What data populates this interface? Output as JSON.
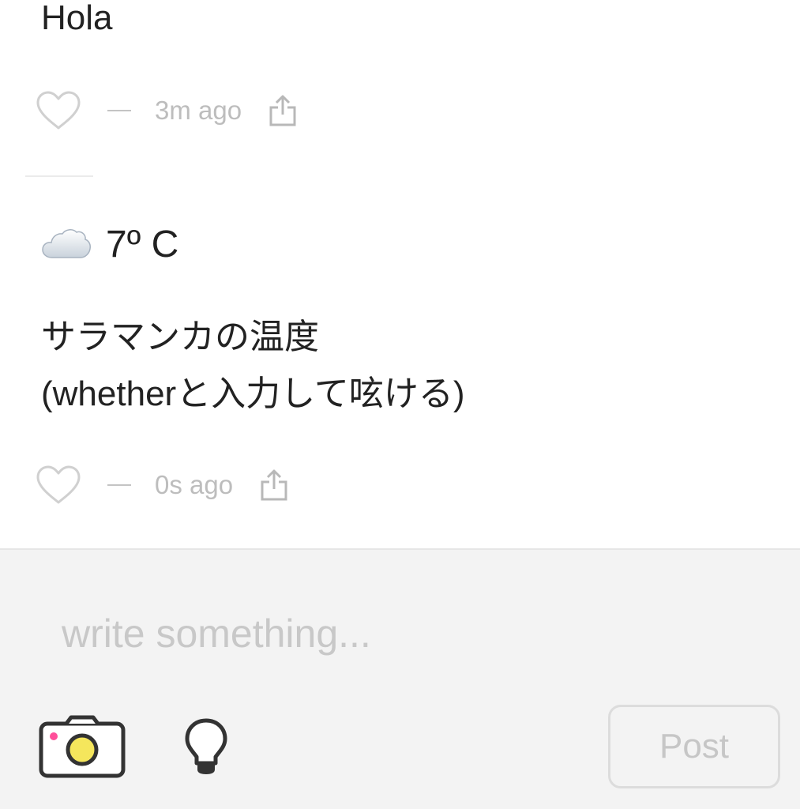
{
  "feed": {
    "posts": [
      {
        "text": "Hola",
        "time": "3m ago",
        "like_icon": "heart-outline-icon",
        "share_icon": "share-icon"
      },
      {
        "weather": {
          "icon": "cloud-icon",
          "temperature": "7º C"
        },
        "text_line1": "サラマンカの温度",
        "text_line2": "(whetherと入力して呟ける)",
        "time": "0s ago",
        "like_icon": "heart-outline-icon",
        "share_icon": "share-icon"
      }
    ]
  },
  "composer": {
    "placeholder": "write something...",
    "camera_icon": "camera-icon",
    "idea_icon": "lightbulb-icon",
    "post_label": "Post"
  },
  "colors": {
    "text": "#222222",
    "muted": "#bdbdbd",
    "composer_background": "#f3f3f3",
    "camera_accent": "#ff4f9a",
    "camera_lens": "#f5e65c"
  }
}
